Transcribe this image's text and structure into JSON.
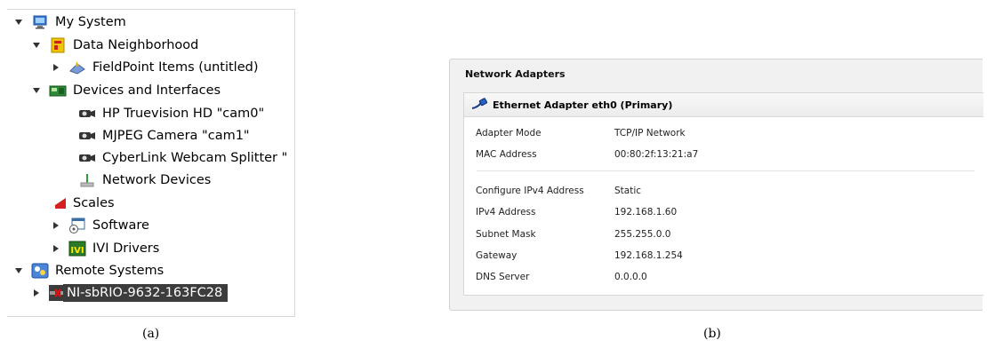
{
  "tree": {
    "items": [
      {
        "label": "My System"
      },
      {
        "label": "Data Neighborhood"
      },
      {
        "label": "FieldPoint Items (untitled)"
      },
      {
        "label": "Devices and Interfaces"
      },
      {
        "label": "HP Truevision HD  \"cam0\""
      },
      {
        "label": "MJPEG Camera  \"cam1\""
      },
      {
        "label": "CyberLink Webcam Splitter  \""
      },
      {
        "label": "Network Devices"
      },
      {
        "label": "Scales"
      },
      {
        "label": "Software"
      },
      {
        "label": "IVI Drivers"
      },
      {
        "label": "Remote Systems"
      },
      {
        "label": "NI-sbRIO-9632-163FC28"
      }
    ]
  },
  "network": {
    "title": "Network Adapters",
    "adapter_name": "Ethernet Adapter eth0 (Primary)",
    "properties": [
      {
        "label": "Adapter Mode",
        "value": "TCP/IP Network"
      },
      {
        "label": "MAC Address",
        "value": "00:80:2f:13:21:a7"
      },
      {
        "label": "Configure IPv4 Address",
        "value": "Static"
      },
      {
        "label": "IPv4 Address",
        "value": "192.168.1.60"
      },
      {
        "label": "Subnet Mask",
        "value": "255.255.0.0"
      },
      {
        "label": "Gateway",
        "value": "192.168.1.254"
      },
      {
        "label": "DNS Server",
        "value": "0.0.0.0"
      }
    ]
  },
  "captions": {
    "a": "(a)",
    "b": "(b)"
  }
}
